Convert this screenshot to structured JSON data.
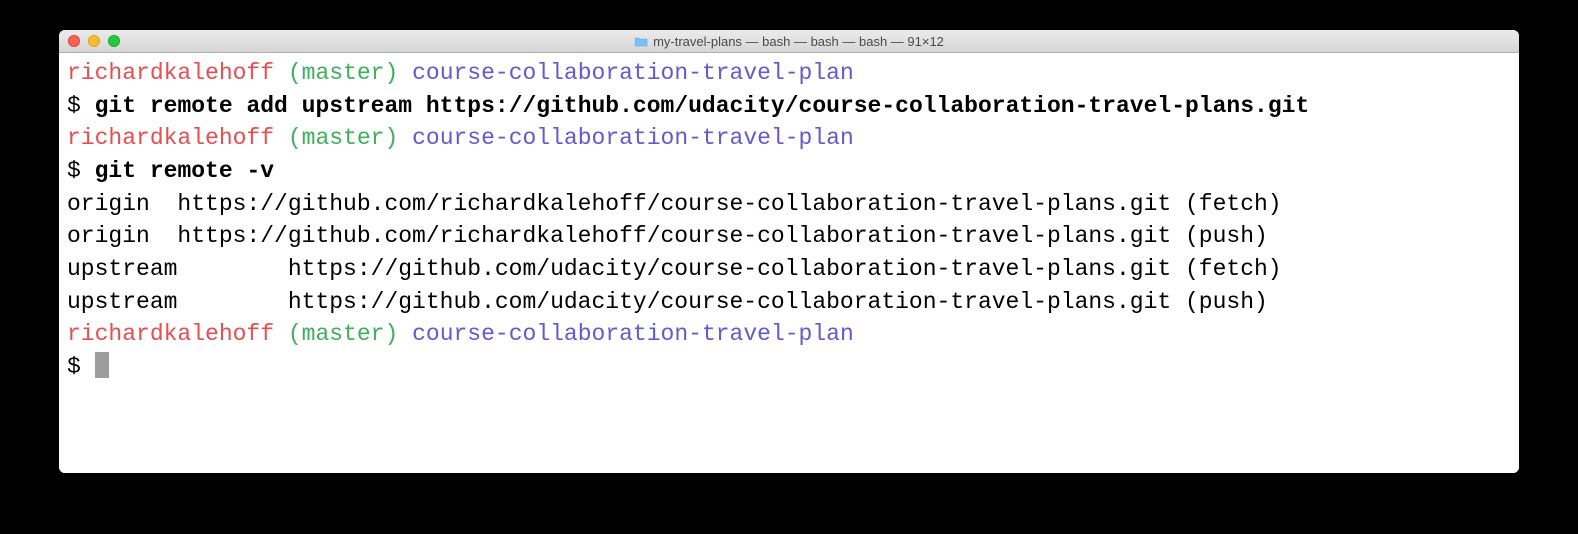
{
  "window": {
    "title": "my-travel-plans — bash — bash — bash — 91×12"
  },
  "prompt": {
    "user": "richardkalehoff",
    "branch": "(master)",
    "path": "course-collaboration-travel-plan",
    "symbol": "$"
  },
  "commands": {
    "cmd1": "git remote add upstream https://github.com/udacity/course-collaboration-travel-plans.git",
    "cmd2": "git remote -v"
  },
  "output": {
    "line1": "origin  https://github.com/richardkalehoff/course-collaboration-travel-plans.git (fetch)",
    "line2": "origin  https://github.com/richardkalehoff/course-collaboration-travel-plans.git (push)",
    "line3": "upstream        https://github.com/udacity/course-collaboration-travel-plans.git (fetch)",
    "line4": "upstream        https://github.com/udacity/course-collaboration-travel-plans.git (push)"
  }
}
